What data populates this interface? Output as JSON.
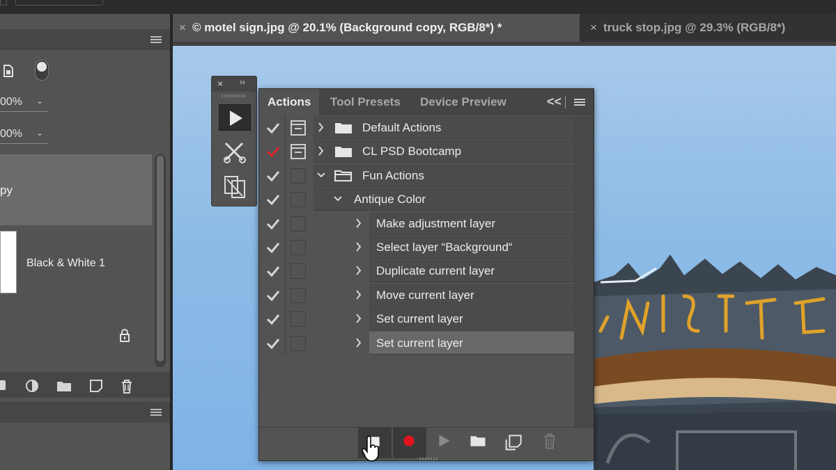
{
  "document_tabs": [
    {
      "label": "© motel sign.jpg @ 20.1% (Background copy, RGB/8*) *",
      "active": true
    },
    {
      "label": "truck stop.jpg @ 29.3% (RGB/8*)",
      "active": false
    }
  ],
  "tab_close_glyph": "×",
  "layers_panel": {
    "opacity_value": "00%",
    "fill_value": "00%",
    "layers": [
      {
        "name": "py",
        "selected": true
      },
      {
        "name": "Black & White 1",
        "selected": false
      }
    ],
    "footer_icons": [
      "adjustment-layer-icon",
      "group-folder-icon",
      "new-layer-icon",
      "delete-icon"
    ]
  },
  "mini_panel": {
    "close_glyph": "×",
    "collapse_glyph": "››",
    "icons": [
      "play-icon",
      "tool-presets-icon",
      "device-preview-icon"
    ]
  },
  "actions_panel": {
    "tabs": [
      "Actions",
      "Tool Presets",
      "Device Preview"
    ],
    "collapse_glyph": "<<",
    "rows": [
      {
        "label": "Default Actions",
        "type": "set",
        "expanded": false,
        "check_color": "#d6d6d6",
        "dialog": true
      },
      {
        "label": "CL PSD Bootcamp",
        "type": "set",
        "expanded": false,
        "check_color": "#d9262c",
        "dialog": true
      },
      {
        "label": "Fun Actions",
        "type": "set",
        "expanded": true,
        "check_color": "#d6d6d6",
        "dialog": false
      },
      {
        "label": "Antique Color",
        "type": "action",
        "expanded": true,
        "check_color": "#d6d6d6",
        "dialog": false
      },
      {
        "label": "Make adjustment layer",
        "type": "step",
        "check_color": "#d6d6d6",
        "dialog": false
      },
      {
        "label": "Select layer “Background“",
        "type": "step",
        "check_color": "#d6d6d6",
        "dialog": false
      },
      {
        "label": "Duplicate current layer",
        "type": "step",
        "check_color": "#d6d6d6",
        "dialog": false
      },
      {
        "label": "Move current layer",
        "type": "step",
        "check_color": "#d6d6d6",
        "dialog": false
      },
      {
        "label": "Set current layer",
        "type": "step",
        "check_color": "#d6d6d6",
        "dialog": false
      },
      {
        "label": "Set current layer",
        "type": "step",
        "check_color": "#d6d6d6",
        "dialog": false,
        "selected": true
      }
    ],
    "bottom_buttons": [
      "stop-icon",
      "record-icon",
      "play-icon",
      "new-set-folder-icon",
      "new-action-icon",
      "delete-icon"
    ],
    "record_color": "#e0131f"
  },
  "colors": {
    "panel_bg": "#535353",
    "sky": "#8dbbe6",
    "neon_sign": "#e0a22a"
  }
}
